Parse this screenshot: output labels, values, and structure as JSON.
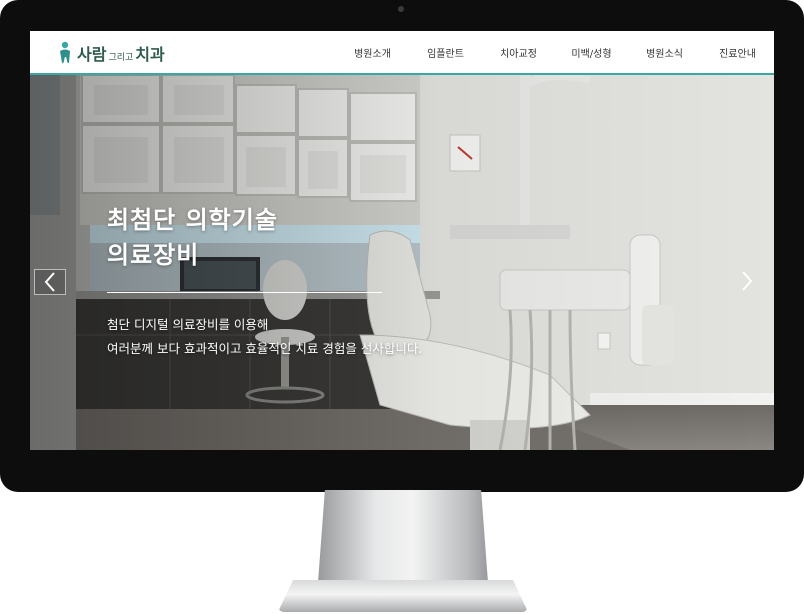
{
  "logo": {
    "main": "사람",
    "sub": "그리고",
    "main2": "치과"
  },
  "nav": {
    "items": [
      {
        "label": "병원소개"
      },
      {
        "label": "임플란트"
      },
      {
        "label": "치아교정"
      },
      {
        "label": "미백/성형"
      },
      {
        "label": "병원소식"
      },
      {
        "label": "진료안내"
      }
    ]
  },
  "hero": {
    "title_line1": "최첨단 의학기술",
    "title_line2": "의료장비",
    "desc_line1": "첨단 디지털 의료장비를 이용해",
    "desc_line2": "여러분께 보다 효과적이고 효율적인 치료 경험을 선사합니다."
  },
  "icons": {
    "logo": "tooth-person-icon",
    "prev": "chevron-left-icon",
    "next": "chevron-right-icon"
  },
  "colors": {
    "accent": "#3aa8a2",
    "logo_text": "#2f5b4f",
    "bezel": "#0d0d0d"
  }
}
